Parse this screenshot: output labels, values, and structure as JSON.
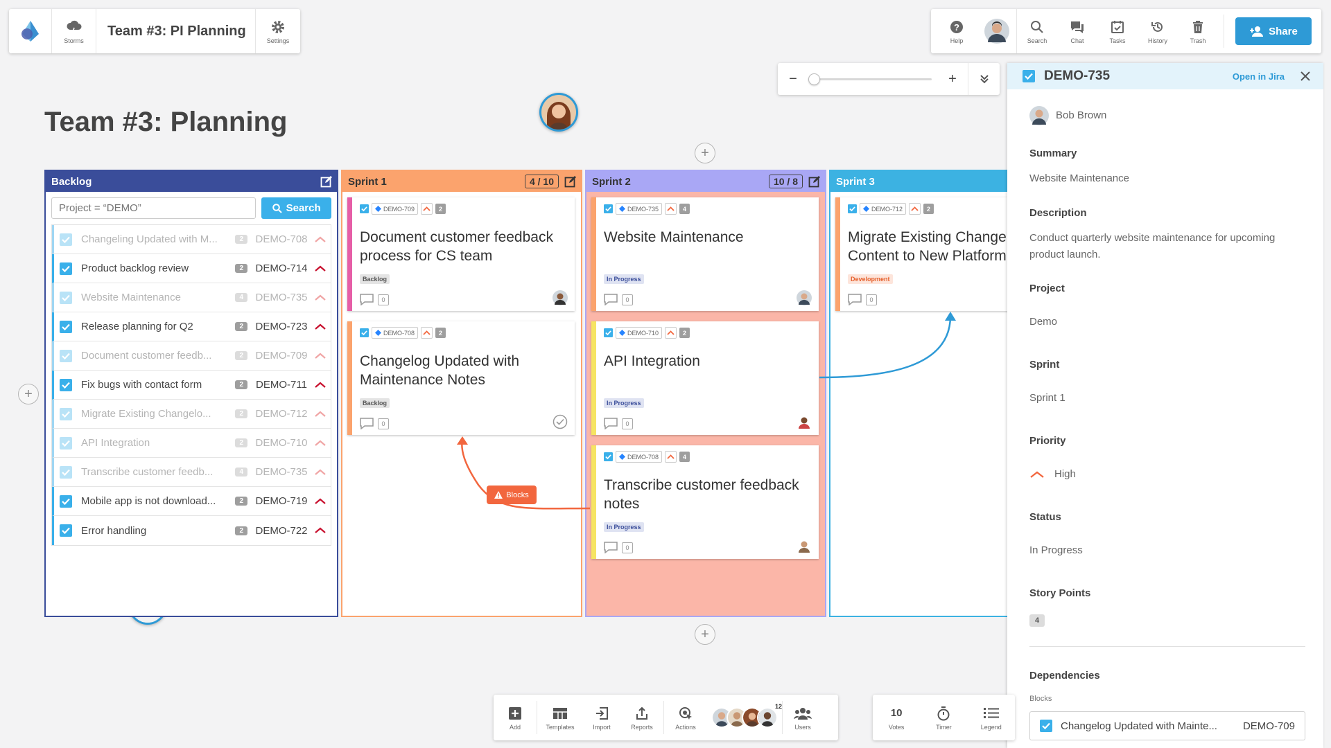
{
  "toolbar_left": {
    "storms_label": "Storms",
    "board_title": "Team #3: PI Planning",
    "settings_label": "Settings"
  },
  "toolbar_right": {
    "help_label": "Help",
    "search_label": "Search",
    "chat_label": "Chat",
    "tasks_label": "Tasks",
    "history_label": "History",
    "trash_label": "Trash",
    "share_label": "Share"
  },
  "zoom": {
    "minus": "−",
    "plus": "+",
    "level": 0.0
  },
  "page_title": "Team #3: Planning",
  "columns": {
    "backlog": {
      "title": "Backlog",
      "search_placeholder": "Project = “DEMO”",
      "search_button": "Search",
      "items": [
        {
          "title": "Changeling Updated with M...",
          "points": "2",
          "key": "DEMO-708",
          "dimmed": true
        },
        {
          "title": "Product backlog review",
          "points": "2",
          "key": "DEMO-714",
          "dimmed": false
        },
        {
          "title": "Website Maintenance",
          "points": "4",
          "key": "DEMO-735",
          "dimmed": true
        },
        {
          "title": "Release planning for Q2",
          "points": "2",
          "key": "DEMO-723",
          "dimmed": false
        },
        {
          "title": "Document customer feedb...",
          "points": "2",
          "key": "DEMO-709",
          "dimmed": true
        },
        {
          "title": "Fix bugs with contact form",
          "points": "2",
          "key": "DEMO-711",
          "dimmed": false
        },
        {
          "title": "Migrate Existing Changelo...",
          "points": "2",
          "key": "DEMO-712",
          "dimmed": true
        },
        {
          "title": "API Integration",
          "points": "2",
          "key": "DEMO-710",
          "dimmed": true
        },
        {
          "title": "Transcribe customer feedb...",
          "points": "4",
          "key": "DEMO-735",
          "dimmed": true
        },
        {
          "title": "Mobile app is not download...",
          "points": "2",
          "key": "DEMO-719",
          "dimmed": false
        },
        {
          "title": "Error handling",
          "points": "2",
          "key": "DEMO-722",
          "dimmed": false
        }
      ]
    },
    "sprint1": {
      "title": "Sprint 1",
      "count": "4 / 10",
      "cards": [
        {
          "key": "DEMO-709",
          "points": "2",
          "title_l1": "Document customer feedback",
          "title_l2": "process for CS team",
          "status": "Backlog",
          "comments": "0"
        },
        {
          "key": "DEMO-708",
          "points": "2",
          "title_l1": "Changelog Updated with",
          "title_l2": "Maintenance Notes",
          "status": "Backlog",
          "comments": "0"
        }
      ]
    },
    "sprint2": {
      "title": "Sprint 2",
      "count": "10 / 8",
      "cards": [
        {
          "key": "DEMO-735",
          "points": "4",
          "title_l1": "Website Maintenance",
          "title_l2": "",
          "status": "In Progress",
          "comments": "0"
        },
        {
          "key": "DEMO-710",
          "points": "2",
          "title_l1": "API Integration",
          "title_l2": "",
          "status": "In Progress",
          "comments": "0"
        },
        {
          "key": "DEMO-708",
          "points": "4",
          "title_l1": "Transcribe customer feedback",
          "title_l2": "notes",
          "status": "In Progress",
          "comments": "0"
        }
      ]
    },
    "sprint3": {
      "title": "Sprint 3",
      "cards": [
        {
          "key": "DEMO-712",
          "points": "2",
          "title_l1": "Migrate Existing Changelog",
          "title_l2": "Content to New Platform",
          "status": "Development",
          "comments": "0"
        }
      ]
    }
  },
  "dependency_tag": "Blocks",
  "detail": {
    "key": "DEMO-735",
    "open_label": "Open in Jira",
    "assignee": "Bob Brown",
    "summary_label": "Summary",
    "summary": "Website Maintenance",
    "description_label": "Description",
    "description_l1": "Conduct quarterly website maintenance for upcoming",
    "description_l2": "product launch.",
    "project_label": "Project",
    "project": "Demo",
    "sprint_label": "Sprint",
    "sprint": "Sprint 1",
    "priority_label": "Priority",
    "priority": "High",
    "status_label": "Status",
    "status": "In Progress",
    "points_label": "Story Points",
    "points": "4",
    "dependencies_label": "Dependencies",
    "blocks_label": "Blocks",
    "dep_title": "Changelog Updated with Mainte...",
    "dep_key": "DEMO-709"
  },
  "bottombar": {
    "add": "Add",
    "templates": "Templates",
    "import": "Import",
    "reports": "Reports",
    "actions": "Actions",
    "more_users": "12",
    "users": "Users"
  },
  "votesbar": {
    "votes_count": "10",
    "votes": "Votes",
    "timer": "Timer",
    "legend": "Legend"
  },
  "colors": {
    "accent": "#2e9ad6",
    "backlog_header": "#3a4d9a",
    "sprint1_header": "#fba36d",
    "sprint2_header": "#a9a7f5",
    "sprint3_header": "#3cb2e2",
    "blocks": "#f2663e"
  },
  "icons": [
    "storms-cloud-icon",
    "gear-icon",
    "help-icon",
    "search-icon",
    "chat-icon",
    "tasks-icon",
    "history-icon",
    "trash-icon",
    "add-user-icon",
    "edit-icon",
    "checkbox-icon",
    "chevron-up-icon",
    "comment-icon",
    "close-icon",
    "timer-icon",
    "legend-icon"
  ]
}
